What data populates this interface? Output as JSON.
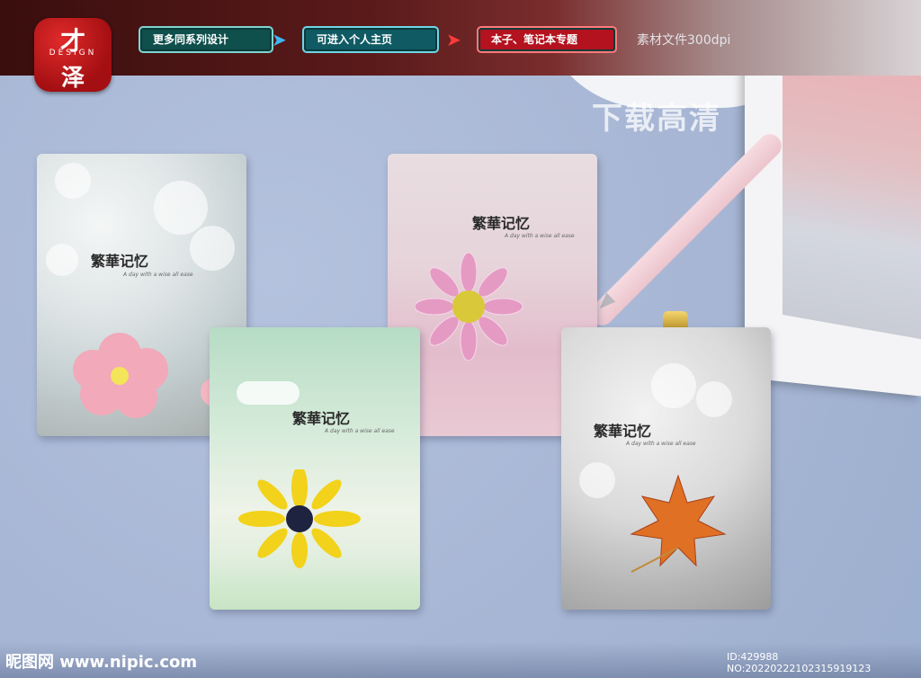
{
  "brand": {
    "logo_top": "才",
    "logo_mid": "DESIGN",
    "logo_bottom": "泽"
  },
  "nav": {
    "btn1": "更多同系列设计",
    "btn2": "可进入个人主页",
    "btn3": "本子、笔记本专题",
    "right_text": "素材文件300dpi"
  },
  "download_label": "下载高清",
  "notebooks": [
    {
      "title": "繁華记忆",
      "subtitle": "A day with a wise all ease",
      "flower": "pink-camellia"
    },
    {
      "title": "繁華记忆",
      "subtitle": "A day with a wise all ease",
      "flower": "pink-daisy"
    },
    {
      "title": "繁華记忆",
      "subtitle": "A day with a wise all ease",
      "flower": "yellow-sunflower"
    },
    {
      "title": "繁華记忆",
      "subtitle": "A day with a wise all ease",
      "flower": "maple-leaf"
    }
  ],
  "footer": {
    "site": "昵图网 www.nipic.com",
    "id_text": "ID:429988 NO:20220222102315919123"
  },
  "colors": {
    "banner_dark": "#3a0e0e",
    "logo_red": "#c0161b",
    "desk_blue": "#aab8d6"
  }
}
